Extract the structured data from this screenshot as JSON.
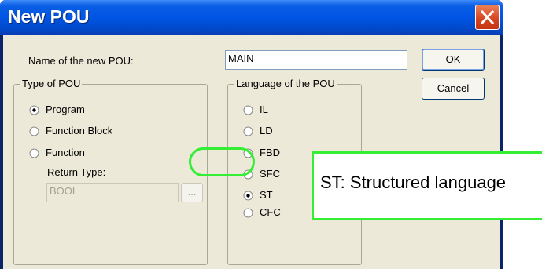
{
  "dialog": {
    "title": "New POU",
    "name_label": "Name of the new POU:",
    "name_value": "MAIN",
    "ok_label": "OK",
    "cancel_label": "Cancel"
  },
  "type_group": {
    "title": "Type of POU",
    "options": [
      "Program",
      "Function Block",
      "Function"
    ],
    "selected": "Program",
    "return_type_label": "Return Type:",
    "return_type_value": "BOOL",
    "browse_label": "..."
  },
  "language_group": {
    "title": "Language of the POU",
    "options": [
      "IL",
      "LD",
      "FBD",
      "SFC",
      "ST",
      "CFC"
    ],
    "selected": "ST"
  },
  "annotation": {
    "callout_text": "ST: Structured language",
    "color": "#33ee33"
  },
  "colors": {
    "titlebar": "#0055e5",
    "dialog_bg": "#ece9d8",
    "close_button": "#d5431d"
  }
}
